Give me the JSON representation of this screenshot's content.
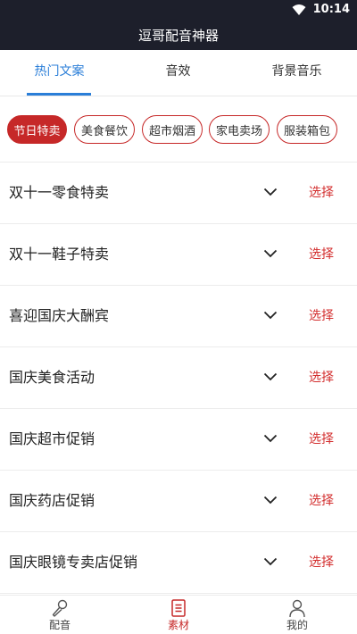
{
  "status_bar": {
    "time": "10:14"
  },
  "app": {
    "title": "逗哥配音神器"
  },
  "tabs": [
    {
      "label": "热门文案"
    },
    {
      "label": "音效"
    },
    {
      "label": "背景音乐"
    }
  ],
  "categories": [
    {
      "label": "节日特卖"
    },
    {
      "label": "美食餐饮"
    },
    {
      "label": "超市烟酒"
    },
    {
      "label": "家电卖场"
    },
    {
      "label": "服装箱包"
    }
  ],
  "items": [
    {
      "title": "双十一零食特卖",
      "action": "选择"
    },
    {
      "title": "双十一鞋子特卖",
      "action": "选择"
    },
    {
      "title": "喜迎国庆大酬宾",
      "action": "选择"
    },
    {
      "title": "国庆美食活动",
      "action": "选择"
    },
    {
      "title": "国庆超市促销",
      "action": "选择"
    },
    {
      "title": "国庆药店促销",
      "action": "选择"
    },
    {
      "title": "国庆眼镜专卖店促销",
      "action": "选择"
    }
  ],
  "bottom_nav": [
    {
      "label": "配音",
      "icon": "microphone-icon"
    },
    {
      "label": "素材",
      "icon": "document-icon"
    },
    {
      "label": "我的",
      "icon": "person-icon"
    }
  ],
  "colors": {
    "header_bg": "#1d1f2b",
    "tab_active": "#2a7ed8",
    "accent_red": "#c62828"
  }
}
